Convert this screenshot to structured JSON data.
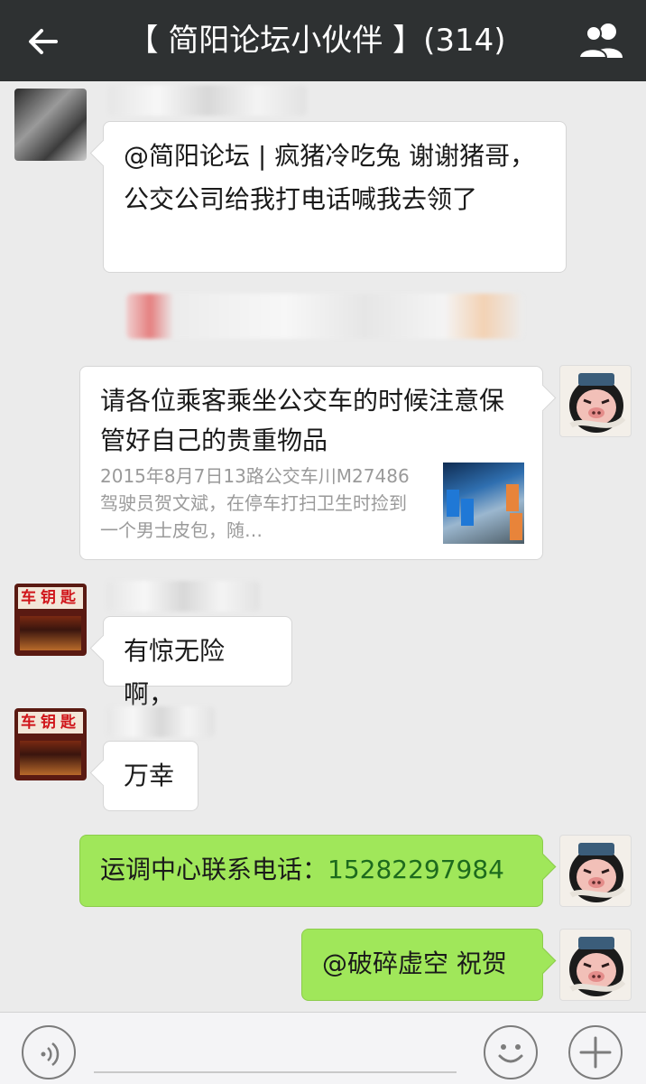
{
  "header": {
    "title": "【 简阳论坛小伙伴 】(314)",
    "back_icon": "back-arrow-icon",
    "members_icon": "group-members-icon",
    "background": "#2e3132"
  },
  "messages": [
    {
      "text": "@简阳论坛 | 疯猪冷吃兔 谢谢猪哥，公交公司给我打电话喊我去领了"
    },
    {
      "article": {
        "title": "请各位乘客乘坐公交车的时候注意保管好自己的贵重物品",
        "desc": "2015年8月7日13路公交车川M27486驾驶员贺文斌，在停车打扫卫生时捡到一个男士皮包，随…"
      }
    },
    {
      "text": "有惊无险啊，"
    },
    {
      "text": "万幸"
    },
    {
      "prefix": "运调中心联系电话：",
      "phone": "15282297984"
    },
    {
      "text": "@破碎虚空 祝贺"
    }
  ],
  "avatars": {
    "shop_sign": "车钥匙"
  },
  "inputbar": {
    "voice_icon": "voice-icon",
    "emoji_icon": "emoji-icon",
    "add_icon": "plus-icon"
  },
  "colors": {
    "sent_bubble": "#a0e75a",
    "received_bubble": "#ffffff",
    "chat_background": "#ebebeb"
  }
}
